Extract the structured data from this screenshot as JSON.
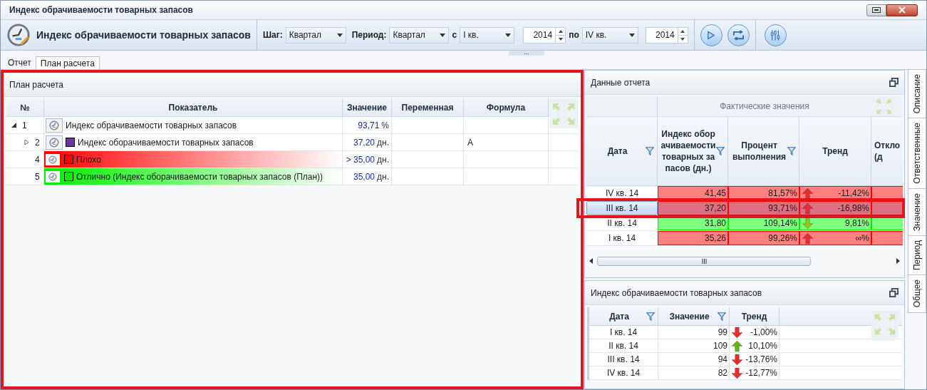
{
  "window": {
    "title": "Индекс обрачиваемости товарных запасов"
  },
  "toolbar": {
    "title": "Индекс обрачиваемости товарных запасов",
    "step": {
      "label": "Шаг:",
      "value": "Квартал"
    },
    "period": {
      "label": "Период:",
      "value": "Квартал"
    },
    "from": {
      "label": "с",
      "quarter": "I кв.",
      "year": "2014"
    },
    "to": {
      "label": "по",
      "quarter": "IV кв.",
      "year": "2014"
    },
    "more": "..."
  },
  "tabs": [
    {
      "label": "Отчет",
      "selected": false
    },
    {
      "label": "План расчета",
      "selected": true
    }
  ],
  "plan": {
    "title": "План расчета",
    "columns": [
      "№",
      "Показатель",
      "Значение",
      "Переменная",
      "Формула"
    ],
    "rows": [
      {
        "kind": "indicator",
        "number": "1",
        "expanded": true,
        "indicator": "Индекс обрачиваемости товарных запасов",
        "value": "93,71",
        "unit": "%",
        "children": [
          {
            "kind": "indicator",
            "number": "2",
            "expanded": false,
            "color": "#6b35a0",
            "indicator": "Индекс оборачиваемости товарных запасов",
            "value": "37,20",
            "unit": "дн.",
            "formula": "A"
          },
          {
            "kind": "condition",
            "number": "4",
            "color": "#ff0000",
            "indicator": "Плохо",
            "value": "> 35,00",
            "unit": "дн."
          },
          {
            "kind": "condition",
            "number": "5",
            "color": "#00ee00",
            "indicator": "Отлично (Индекс оборачиваемости товарных запасов (План))",
            "value": "35,00",
            "unit": "дн."
          }
        ]
      }
    ]
  },
  "report": {
    "title": "Данные отчета",
    "group": "Фактические значения",
    "columns": [
      "Дата",
      "Индекс оборачиваемости товарных запасов (дн.)",
      "Процент выполнения",
      "Тренд",
      "Откло (д"
    ],
    "rows": [
      {
        "date": "IV кв. 14",
        "index": "41,45",
        "percent": "81,57%",
        "kind": "up",
        "trend_value": "-11,42%",
        "color": "#ff8080",
        "selected": false
      },
      {
        "date": "III кв. 14",
        "index": "37,20",
        "percent": "93,71%",
        "kind": "up",
        "trend_value": "-16,98%",
        "color": "#e07080",
        "selected": true
      },
      {
        "date": "II кв. 14",
        "index": "31,80",
        "percent": "109,14%",
        "kind": "down",
        "trend_value": "9,81%",
        "color": "#80ff80",
        "selected": false
      },
      {
        "date": "I кв. 14",
        "index": "35,26",
        "percent": "99,26%",
        "kind": "up",
        "trend_value": "∞%",
        "color": "#ff8080",
        "selected": false
      }
    ]
  },
  "history": {
    "title": "Индекс обрачиваемости товарных запасов",
    "columns": [
      "Дата",
      "Значение",
      "Тренд"
    ],
    "rows": [
      {
        "date": "I кв. 14",
        "value": "99",
        "kind": "down",
        "trend_value": "-1,00%"
      },
      {
        "date": "II кв. 14",
        "value": "109",
        "kind": "up",
        "trend_value": "10,10%"
      },
      {
        "date": "III кв. 14",
        "value": "94",
        "kind": "down",
        "trend_value": "-13,76%"
      },
      {
        "date": "IV кв. 14",
        "value": "82",
        "kind": "down",
        "trend_value": "-12,77%"
      }
    ]
  },
  "side_tabs": [
    {
      "label": "Описание",
      "selected": false
    },
    {
      "label": "Ответственные",
      "selected": false
    },
    {
      "label": "Значение",
      "selected": false
    },
    {
      "label": "Период",
      "selected": false
    },
    {
      "label": "Общее",
      "selected": false
    }
  ]
}
